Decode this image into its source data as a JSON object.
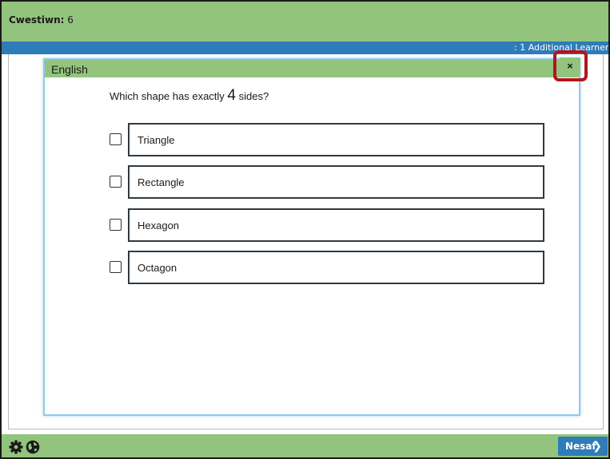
{
  "header": {
    "question_label": "Cwestiwn:",
    "question_number": "6"
  },
  "strip": {
    "text": ": 1 Additional Learner"
  },
  "dialog": {
    "title": "English",
    "close_label": "×"
  },
  "question": {
    "text_before": "Which shape has exactly ",
    "number": "4",
    "text_after": " sides?"
  },
  "options": [
    {
      "label": "Triangle",
      "checked": false
    },
    {
      "label": "Rectangle",
      "checked": false
    },
    {
      "label": "Hexagon",
      "checked": false
    },
    {
      "label": "Octagon",
      "checked": false
    }
  ],
  "footer": {
    "settings_icon": "gear-icon",
    "language_icon": "globe-icon",
    "next_label": "Nesaf",
    "next_icon": "chevron-right-icon"
  },
  "colors": {
    "green_bar": "#93c47d",
    "blue_strip": "#2e7cb8",
    "highlight_red": "#b0161c",
    "dialog_border": "#8ec8ec"
  }
}
